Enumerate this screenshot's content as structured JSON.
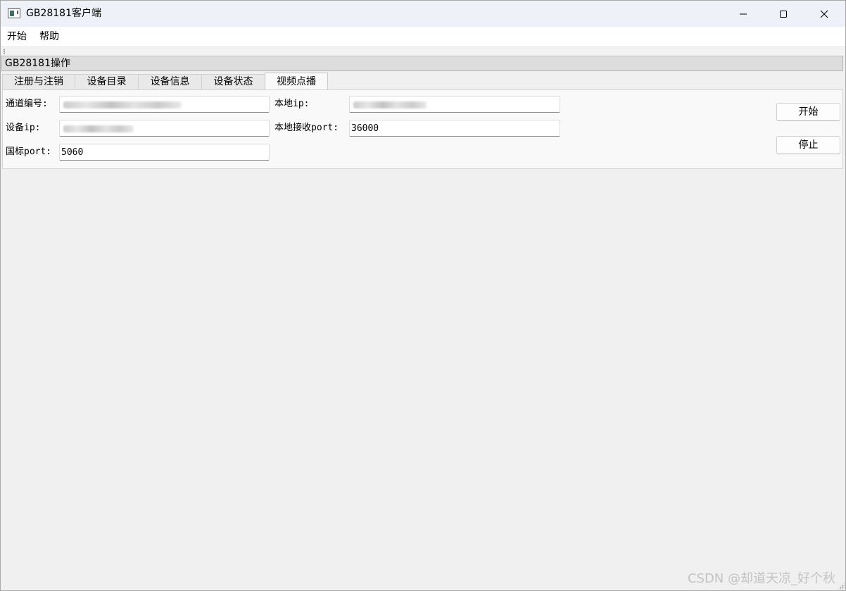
{
  "window": {
    "title": "GB28181客户端",
    "controls": [
      "minimize-icon",
      "maximize-icon",
      "close-icon"
    ]
  },
  "menubar": {
    "items": [
      "开始",
      "帮助"
    ]
  },
  "dock": {
    "title": "GB28181操作"
  },
  "tabs": [
    {
      "label": "注册与注销",
      "active": false
    },
    {
      "label": "设备目录",
      "active": false
    },
    {
      "label": "设备信息",
      "active": false
    },
    {
      "label": "设备状态",
      "active": false
    },
    {
      "label": "视频点播",
      "active": true
    }
  ],
  "form": {
    "channel_id": {
      "label": "通道编号:",
      "value": ""
    },
    "local_ip": {
      "label": "本地ip:",
      "value": ""
    },
    "device_ip": {
      "label": "设备ip:",
      "value": ""
    },
    "local_recv_port": {
      "label": "本地接收port:",
      "value": "36000"
    },
    "gb_port": {
      "label": "国标port:",
      "value": "5060"
    }
  },
  "buttons": {
    "start": "开始",
    "stop": "停止"
  },
  "watermark": "CSDN @却道天凉_好个秋"
}
